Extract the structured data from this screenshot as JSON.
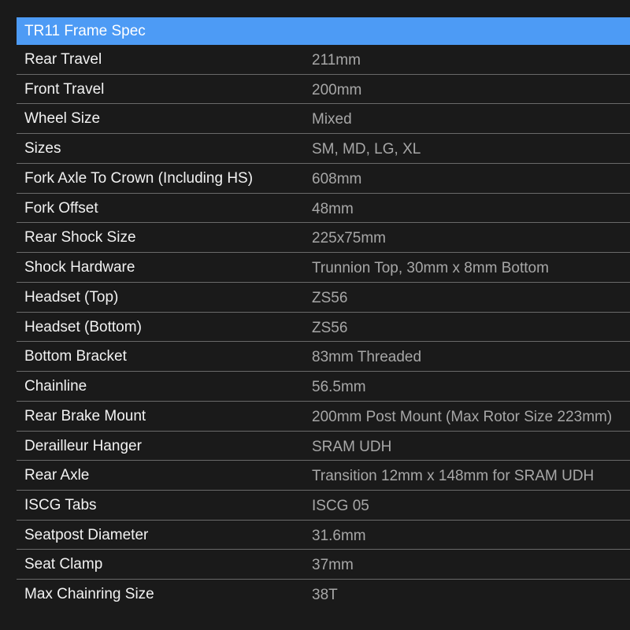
{
  "table": {
    "title": "TR11 Frame Spec",
    "rows": [
      {
        "label": "Rear Travel",
        "value": "211mm"
      },
      {
        "label": "Front Travel",
        "value": "200mm"
      },
      {
        "label": "Wheel Size",
        "value": "Mixed"
      },
      {
        "label": "Sizes",
        "value": "SM, MD, LG, XL"
      },
      {
        "label": "Fork Axle To Crown (Including HS)",
        "value": "608mm"
      },
      {
        "label": "Fork Offset",
        "value": "48mm"
      },
      {
        "label": "Rear Shock Size",
        "value": "225x75mm"
      },
      {
        "label": "Shock Hardware",
        "value": "Trunnion Top, 30mm x 8mm Bottom"
      },
      {
        "label": "Headset (Top)",
        "value": "ZS56"
      },
      {
        "label": "Headset (Bottom)",
        "value": "ZS56"
      },
      {
        "label": "Bottom Bracket",
        "value": "83mm Threaded"
      },
      {
        "label": "Chainline",
        "value": "56.5mm"
      },
      {
        "label": "Rear Brake Mount",
        "value": "200mm Post Mount (Max Rotor Size 223mm)"
      },
      {
        "label": "Derailleur Hanger",
        "value": "SRAM UDH"
      },
      {
        "label": "Rear Axle",
        "value": "Transition 12mm x 148mm for SRAM UDH"
      },
      {
        "label": "ISCG Tabs",
        "value": "ISCG 05"
      },
      {
        "label": "Seatpost Diameter",
        "value": "31.6mm"
      },
      {
        "label": "Seat Clamp",
        "value": "37mm"
      },
      {
        "label": "Max Chainring Size",
        "value": "38T"
      }
    ],
    "colors": {
      "header_background": "#4d9bf5",
      "page_background": "#1a1a1a",
      "label_text": "#f2f2f2",
      "value_text": "#a7a7a7",
      "divider": "#6a6a6a"
    }
  }
}
